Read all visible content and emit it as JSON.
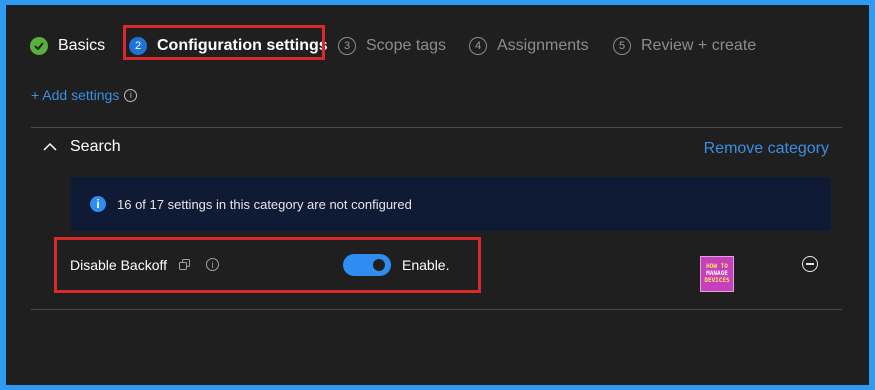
{
  "wizard": {
    "steps": [
      {
        "number": "",
        "label": "Basics",
        "state": "done"
      },
      {
        "number": "2",
        "label": "Configuration settings",
        "state": "active"
      },
      {
        "number": "3",
        "label": "Scope tags",
        "state": "idle"
      },
      {
        "number": "4",
        "label": "Assignments",
        "state": "idle"
      },
      {
        "number": "5",
        "label": "Review + create",
        "state": "idle"
      }
    ]
  },
  "toolbar": {
    "add_settings": "+ Add settings"
  },
  "category": {
    "name": "Search",
    "remove_label": "Remove category",
    "banner_text": "16 of 17 settings in this category are not configured"
  },
  "setting": {
    "name": "Disable Backoff",
    "toggle_label": "Enable.",
    "enabled": true
  },
  "logo": {
    "line1": "HOW TO",
    "line2": "MANAGE",
    "line3": "DEVICES"
  },
  "colors": {
    "accent": "#2f8cf0",
    "highlight": "#d72b2b",
    "success": "#58b13b",
    "background": "#1f1f1f"
  }
}
